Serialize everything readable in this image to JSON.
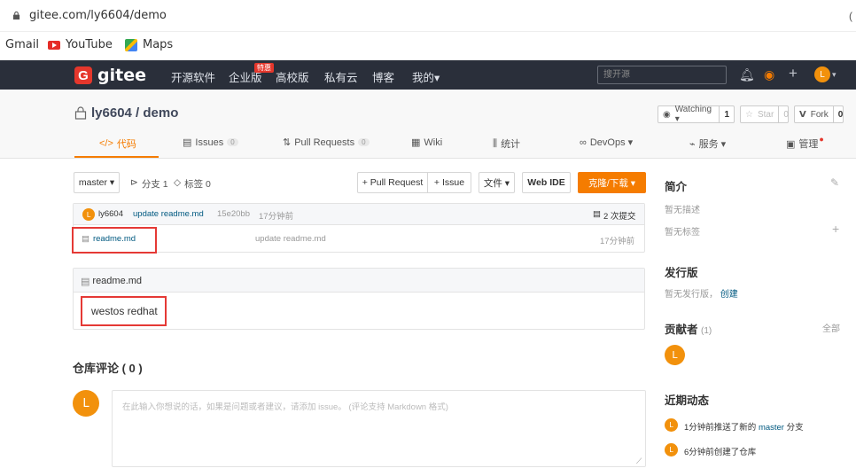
{
  "browser": {
    "url": "gitee.com/ly6604/demo",
    "bookmarks": [
      {
        "label": "Gmail"
      },
      {
        "label": "YouTube"
      },
      {
        "label": "Maps"
      }
    ]
  },
  "nav": {
    "logo": "gitee",
    "logo_letter": "G",
    "items": [
      "开源软件",
      "企业版",
      "高校版",
      "私有云",
      "博客",
      "我的▾"
    ],
    "badge": "特惠",
    "search_placeholder": "搜开源",
    "avatar_letter": "L"
  },
  "repo": {
    "title": "ly6604 / demo",
    "watching_label": "Watching ▾",
    "watching_count": "1",
    "star_label": "Star",
    "star_count": "0",
    "fork_label": "Fork",
    "fork_count": "0",
    "tabs": [
      {
        "label": "代码",
        "icon": "</>"
      },
      {
        "label": "Issues",
        "count": "0"
      },
      {
        "label": "Pull Requests",
        "count": "0"
      },
      {
        "label": "Wiki"
      },
      {
        "label": "统计"
      },
      {
        "label": "DevOps ▾"
      },
      {
        "label": "服务 ▾"
      },
      {
        "label": "管理"
      }
    ]
  },
  "toolbar": {
    "branch": "master ▾",
    "branches": "分支 1",
    "tags": "标签 0",
    "pull_request": "+ Pull Request",
    "issue": "+ Issue",
    "file": "文件 ▾",
    "webide": "Web IDE",
    "clone": "克隆/下载 ▾"
  },
  "commit": {
    "author": "ly6604",
    "message": "update readme.md",
    "hash": "15e20bb",
    "time": "17分钟前",
    "count": "2 次提交"
  },
  "files": [
    {
      "name": "readme.md",
      "message": "update readme.md",
      "time": "17分钟前"
    }
  ],
  "readme": {
    "title": "readme.md",
    "content": "westos redhat"
  },
  "comments": {
    "title": "仓库评论 ( 0 )",
    "placeholder": "在此输入你想说的话，如果是问题或者建议，请添加 issue。 (评论支持 Markdown 格式)"
  },
  "sidebar": {
    "intro_title": "简介",
    "no_desc": "暂无描述",
    "no_tags": "暂无标签",
    "release_title": "发行版",
    "no_release": "暂无发行版，",
    "create_link": "创建",
    "contributors_title": "贡献者",
    "contributors_count": "(1)",
    "all_link": "全部",
    "activity_title": "近期动态",
    "activities": [
      {
        "prefix": "1分钟前推送了新的 ",
        "link": "master",
        "suffix": " 分支"
      },
      {
        "prefix": "6分钟前创建了仓库",
        "link": "",
        "suffix": ""
      }
    ]
  },
  "colors": {
    "brand_red": "#e5372c",
    "accent_orange": "#f57c00",
    "nav_bg": "#2a2f3a",
    "highlight_box": "#e53935"
  }
}
